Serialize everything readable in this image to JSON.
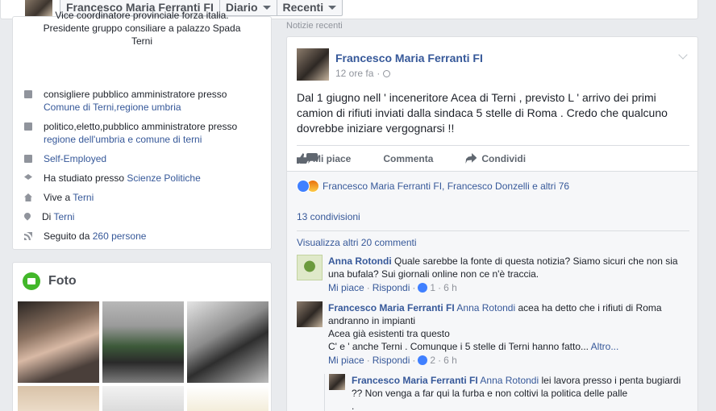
{
  "topnav": {
    "tabs": [
      {
        "label": "Francesco Maria Ferranti FI",
        "has_caret": false
      },
      {
        "label": "Diario",
        "has_caret": true
      },
      {
        "label": "Recenti",
        "has_caret": true
      }
    ]
  },
  "intro": {
    "bio_line1": "Vice coordinatore provinciale forza italia.",
    "bio_line2": "Presidente gruppo consiliare a palazzo Spada",
    "bio_line3": "Terni",
    "work1_text": "consigliere pubblico amministratore presso",
    "work1_link": "Comune di Terni,regione umbria",
    "work2_text": "politico,eletto,pubblico amministratore presso",
    "work2_link": "regione dell'umbria e comune di terni",
    "self_employed": "Self-Employed",
    "study_text": "Ha studiato presso ",
    "study_link": "Scienze Politiche",
    "lives_text": "Vive a ",
    "lives_link": "Terni",
    "from_text": "Di ",
    "from_link": "Terni",
    "followers_text": "Seguito da ",
    "followers_link": "260 persone"
  },
  "foto": {
    "title": "Foto"
  },
  "feed": {
    "section_label": "Notizie recenti"
  },
  "post": {
    "author": "Francesco Maria Ferranti FI",
    "time": "12 ore fa",
    "separator": "·",
    "text": "Dal 1 giugno nell ' inceneritore Acea di Terni , previsto L ' arrivo dei primi camion di rifiuti inviati dalla sindaca 5 stelle di Roma . Credo che qualcuno dovrebbe iniziare vergognarsi !!",
    "actions": {
      "like": "Mi piace",
      "comment": "Commenta",
      "share": "Condividi"
    },
    "reactions_text": "Francesco Maria Ferranti FI, Francesco Donzelli e altri 76",
    "shares": "13 condivisioni",
    "more_comments": "Visualizza altri 20 commenti",
    "comments": [
      {
        "author": "Anna Rotondi",
        "text": "Quale sarebbe la fonte di questa notizia? Siamo sicuri che non sia una bufala? Sui giornali online non ce n'è traccia.",
        "like": "Mi piace",
        "reply": "Rispondi",
        "likes": "1",
        "time": "6 h"
      },
      {
        "author": "Francesco Maria Ferranti FI",
        "mention": "Anna Rotondi",
        "text_line1": " acea ha detto che i rifiuti di Roma andranno in impianti",
        "text_line2": "Acea già esistenti tra questo",
        "text_line3": "C' e ' anche Terni . Comunque i 5 stelle di Terni hanno fatto...",
        "more": " Altro...",
        "like": "Mi piace",
        "reply": "Rispondi",
        "likes": "2",
        "time": "6 h"
      }
    ],
    "reply": {
      "author": "Francesco Maria Ferranti FI",
      "mention": "Anna Rotondi",
      "text": " lei lavora presso i penta bugiardi ?? Non venga a far qui la furba e non coltivi la politica delle palle",
      "text_cont": "."
    }
  }
}
